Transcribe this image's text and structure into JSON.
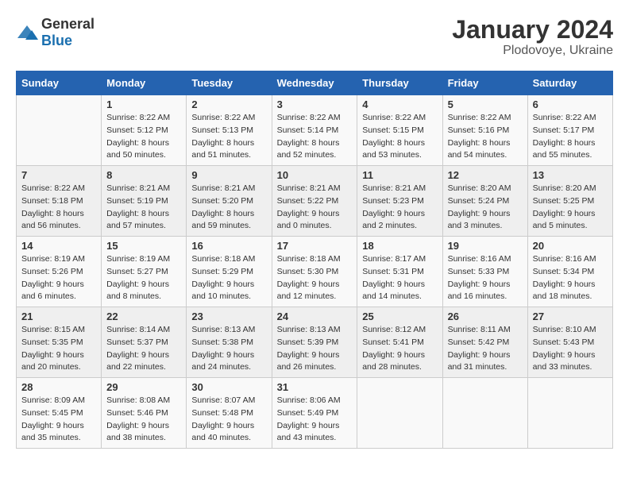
{
  "logo": {
    "general": "General",
    "blue": "Blue"
  },
  "header": {
    "month_year": "January 2024",
    "location": "Plodovoye, Ukraine"
  },
  "days_of_week": [
    "Sunday",
    "Monday",
    "Tuesday",
    "Wednesday",
    "Thursday",
    "Friday",
    "Saturday"
  ],
  "weeks": [
    [
      {
        "day": "",
        "sunrise": "",
        "sunset": "",
        "daylight": ""
      },
      {
        "day": "1",
        "sunrise": "Sunrise: 8:22 AM",
        "sunset": "Sunset: 5:12 PM",
        "daylight": "Daylight: 8 hours and 50 minutes."
      },
      {
        "day": "2",
        "sunrise": "Sunrise: 8:22 AM",
        "sunset": "Sunset: 5:13 PM",
        "daylight": "Daylight: 8 hours and 51 minutes."
      },
      {
        "day": "3",
        "sunrise": "Sunrise: 8:22 AM",
        "sunset": "Sunset: 5:14 PM",
        "daylight": "Daylight: 8 hours and 52 minutes."
      },
      {
        "day": "4",
        "sunrise": "Sunrise: 8:22 AM",
        "sunset": "Sunset: 5:15 PM",
        "daylight": "Daylight: 8 hours and 53 minutes."
      },
      {
        "day": "5",
        "sunrise": "Sunrise: 8:22 AM",
        "sunset": "Sunset: 5:16 PM",
        "daylight": "Daylight: 8 hours and 54 minutes."
      },
      {
        "day": "6",
        "sunrise": "Sunrise: 8:22 AM",
        "sunset": "Sunset: 5:17 PM",
        "daylight": "Daylight: 8 hours and 55 minutes."
      }
    ],
    [
      {
        "day": "7",
        "sunrise": "Sunrise: 8:22 AM",
        "sunset": "Sunset: 5:18 PM",
        "daylight": "Daylight: 8 hours and 56 minutes."
      },
      {
        "day": "8",
        "sunrise": "Sunrise: 8:21 AM",
        "sunset": "Sunset: 5:19 PM",
        "daylight": "Daylight: 8 hours and 57 minutes."
      },
      {
        "day": "9",
        "sunrise": "Sunrise: 8:21 AM",
        "sunset": "Sunset: 5:20 PM",
        "daylight": "Daylight: 8 hours and 59 minutes."
      },
      {
        "day": "10",
        "sunrise": "Sunrise: 8:21 AM",
        "sunset": "Sunset: 5:22 PM",
        "daylight": "Daylight: 9 hours and 0 minutes."
      },
      {
        "day": "11",
        "sunrise": "Sunrise: 8:21 AM",
        "sunset": "Sunset: 5:23 PM",
        "daylight": "Daylight: 9 hours and 2 minutes."
      },
      {
        "day": "12",
        "sunrise": "Sunrise: 8:20 AM",
        "sunset": "Sunset: 5:24 PM",
        "daylight": "Daylight: 9 hours and 3 minutes."
      },
      {
        "day": "13",
        "sunrise": "Sunrise: 8:20 AM",
        "sunset": "Sunset: 5:25 PM",
        "daylight": "Daylight: 9 hours and 5 minutes."
      }
    ],
    [
      {
        "day": "14",
        "sunrise": "Sunrise: 8:19 AM",
        "sunset": "Sunset: 5:26 PM",
        "daylight": "Daylight: 9 hours and 6 minutes."
      },
      {
        "day": "15",
        "sunrise": "Sunrise: 8:19 AM",
        "sunset": "Sunset: 5:27 PM",
        "daylight": "Daylight: 9 hours and 8 minutes."
      },
      {
        "day": "16",
        "sunrise": "Sunrise: 8:18 AM",
        "sunset": "Sunset: 5:29 PM",
        "daylight": "Daylight: 9 hours and 10 minutes."
      },
      {
        "day": "17",
        "sunrise": "Sunrise: 8:18 AM",
        "sunset": "Sunset: 5:30 PM",
        "daylight": "Daylight: 9 hours and 12 minutes."
      },
      {
        "day": "18",
        "sunrise": "Sunrise: 8:17 AM",
        "sunset": "Sunset: 5:31 PM",
        "daylight": "Daylight: 9 hours and 14 minutes."
      },
      {
        "day": "19",
        "sunrise": "Sunrise: 8:16 AM",
        "sunset": "Sunset: 5:33 PM",
        "daylight": "Daylight: 9 hours and 16 minutes."
      },
      {
        "day": "20",
        "sunrise": "Sunrise: 8:16 AM",
        "sunset": "Sunset: 5:34 PM",
        "daylight": "Daylight: 9 hours and 18 minutes."
      }
    ],
    [
      {
        "day": "21",
        "sunrise": "Sunrise: 8:15 AM",
        "sunset": "Sunset: 5:35 PM",
        "daylight": "Daylight: 9 hours and 20 minutes."
      },
      {
        "day": "22",
        "sunrise": "Sunrise: 8:14 AM",
        "sunset": "Sunset: 5:37 PM",
        "daylight": "Daylight: 9 hours and 22 minutes."
      },
      {
        "day": "23",
        "sunrise": "Sunrise: 8:13 AM",
        "sunset": "Sunset: 5:38 PM",
        "daylight": "Daylight: 9 hours and 24 minutes."
      },
      {
        "day": "24",
        "sunrise": "Sunrise: 8:13 AM",
        "sunset": "Sunset: 5:39 PM",
        "daylight": "Daylight: 9 hours and 26 minutes."
      },
      {
        "day": "25",
        "sunrise": "Sunrise: 8:12 AM",
        "sunset": "Sunset: 5:41 PM",
        "daylight": "Daylight: 9 hours and 28 minutes."
      },
      {
        "day": "26",
        "sunrise": "Sunrise: 8:11 AM",
        "sunset": "Sunset: 5:42 PM",
        "daylight": "Daylight: 9 hours and 31 minutes."
      },
      {
        "day": "27",
        "sunrise": "Sunrise: 8:10 AM",
        "sunset": "Sunset: 5:43 PM",
        "daylight": "Daylight: 9 hours and 33 minutes."
      }
    ],
    [
      {
        "day": "28",
        "sunrise": "Sunrise: 8:09 AM",
        "sunset": "Sunset: 5:45 PM",
        "daylight": "Daylight: 9 hours and 35 minutes."
      },
      {
        "day": "29",
        "sunrise": "Sunrise: 8:08 AM",
        "sunset": "Sunset: 5:46 PM",
        "daylight": "Daylight: 9 hours and 38 minutes."
      },
      {
        "day": "30",
        "sunrise": "Sunrise: 8:07 AM",
        "sunset": "Sunset: 5:48 PM",
        "daylight": "Daylight: 9 hours and 40 minutes."
      },
      {
        "day": "31",
        "sunrise": "Sunrise: 8:06 AM",
        "sunset": "Sunset: 5:49 PM",
        "daylight": "Daylight: 9 hours and 43 minutes."
      },
      {
        "day": "",
        "sunrise": "",
        "sunset": "",
        "daylight": ""
      },
      {
        "day": "",
        "sunrise": "",
        "sunset": "",
        "daylight": ""
      },
      {
        "day": "",
        "sunrise": "",
        "sunset": "",
        "daylight": ""
      }
    ]
  ]
}
